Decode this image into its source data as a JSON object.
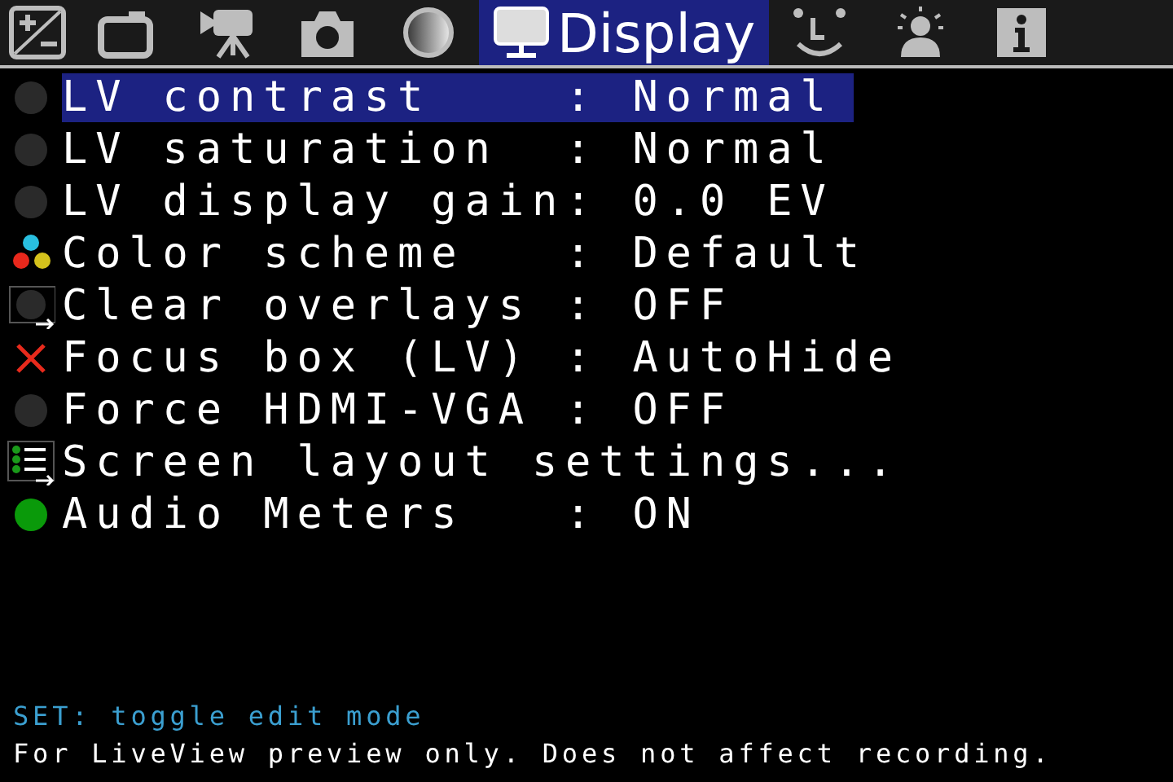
{
  "tabs": [
    {
      "kind": "exposure",
      "selected": false
    },
    {
      "kind": "shoot",
      "selected": false
    },
    {
      "kind": "movie",
      "selected": false
    },
    {
      "kind": "camera",
      "selected": false
    },
    {
      "kind": "gradient",
      "selected": false
    },
    {
      "kind": "display",
      "label": "Display",
      "selected": true
    },
    {
      "kind": "face",
      "selected": false
    },
    {
      "kind": "person",
      "selected": false
    },
    {
      "kind": "info",
      "selected": false
    }
  ],
  "separator": ":",
  "rows": [
    {
      "kind": "off",
      "label": "LV contrast",
      "value": "Normal",
      "selected": true
    },
    {
      "kind": "off",
      "label": "LV saturation",
      "value": "Normal",
      "selected": false
    },
    {
      "kind": "off",
      "label": "LV display gain",
      "value": "0.0 EV",
      "selected": false
    },
    {
      "kind": "palette",
      "label": "Color scheme",
      "value": "Default",
      "selected": false
    },
    {
      "kind": "submenu",
      "label": "Clear overlays",
      "value": "OFF",
      "selected": false
    },
    {
      "kind": "cross",
      "label": "Focus box (LV)",
      "value": "AutoHide",
      "selected": false
    },
    {
      "kind": "off",
      "label": "Force HDMI-VGA",
      "value": "OFF",
      "selected": false
    },
    {
      "kind": "list",
      "label": "Screen layout settings...",
      "selected": false
    },
    {
      "kind": "on",
      "label": "Audio Meters",
      "value": "ON",
      "selected": false
    }
  ],
  "help": "SET: toggle edit mode",
  "info": "For LiveView preview only. Does not affect recording."
}
